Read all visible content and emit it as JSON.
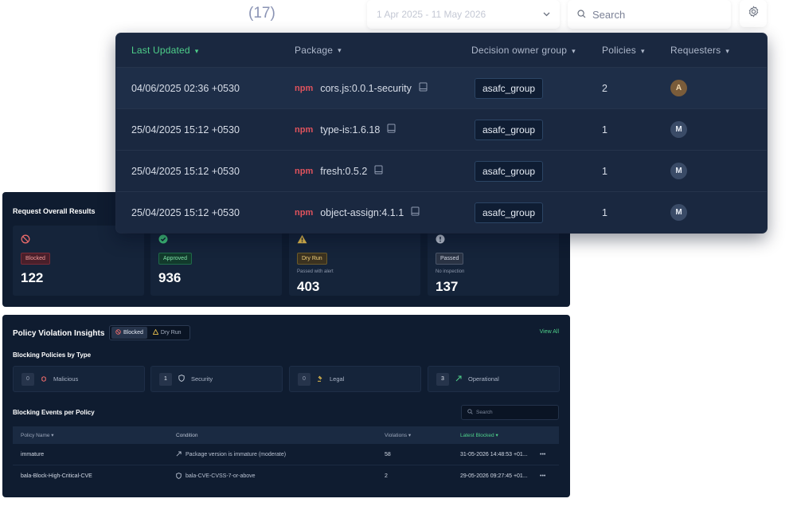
{
  "topbar": {
    "count": "(17)",
    "date_range": "1 Apr 2025 - 11 May 2026",
    "search_placeholder": "Search"
  },
  "packages": {
    "columns": {
      "last_updated": "Last Updated",
      "package": "Package",
      "decision_owner_group": "Decision owner group",
      "policies": "Policies",
      "requesters": "Requesters"
    },
    "rows": [
      {
        "date": "04/06/2025 02:36 +0530",
        "registry": "npm",
        "name": "cors.js:0.0.1-security",
        "group": "asafc_group",
        "policies": "2",
        "requester": "A"
      },
      {
        "date": "25/04/2025 15:12 +0530",
        "registry": "npm",
        "name": "type-is:1.6.18",
        "group": "asafc_group",
        "policies": "1",
        "requester": "M"
      },
      {
        "date": "25/04/2025 15:12 +0530",
        "registry": "npm",
        "name": "fresh:0.5.2",
        "group": "asafc_group",
        "policies": "1",
        "requester": "M"
      },
      {
        "date": "25/04/2025 15:12 +0530",
        "registry": "npm",
        "name": "object-assign:4.1.1",
        "group": "asafc_group",
        "policies": "1",
        "requester": "M"
      }
    ]
  },
  "overall": {
    "title": "Request Overall Results",
    "cards": [
      {
        "badge": "Blocked",
        "sub": "",
        "value": "122"
      },
      {
        "badge": "Approved",
        "sub": "",
        "value": "936"
      },
      {
        "badge": "Dry Run",
        "sub": "Passed with alert",
        "value": "403"
      },
      {
        "badge": "Passed",
        "sub": "No inspection",
        "value": "137"
      }
    ]
  },
  "insights": {
    "title": "Policy Violation Insights",
    "toggle_blocked": "Blocked",
    "toggle_dryrun": "Dry Run",
    "view_all": "View All",
    "by_type_title": "Blocking Policies by Type",
    "types": [
      {
        "count": "0",
        "label": "Malicious"
      },
      {
        "count": "1",
        "label": "Security"
      },
      {
        "count": "0",
        "label": "Legal"
      },
      {
        "count": "3",
        "label": "Operational"
      }
    ],
    "events_title": "Blocking Events per Policy",
    "search_placeholder": "Search",
    "table": {
      "headers": {
        "policy_name": "Policy Name",
        "condition": "Condition",
        "violations": "Violations",
        "latest_blocked": "Latest Blocked"
      },
      "rows": [
        {
          "policy": "immature",
          "condition": "Package version is immature (moderate)",
          "violations": "58",
          "latest": "31-05-2026 14:48:53 +01..."
        },
        {
          "policy": "bala-Block-High-Critical-CVE",
          "condition": "bala-CVE-CVSS-7-or-above",
          "violations": "2",
          "latest": "29-05-2026 09:27:45 +01..."
        }
      ]
    }
  },
  "colors": {
    "accent_green": "#4ed08a",
    "npm_red": "#e1535d",
    "panel_bg": "#0f1c30"
  }
}
